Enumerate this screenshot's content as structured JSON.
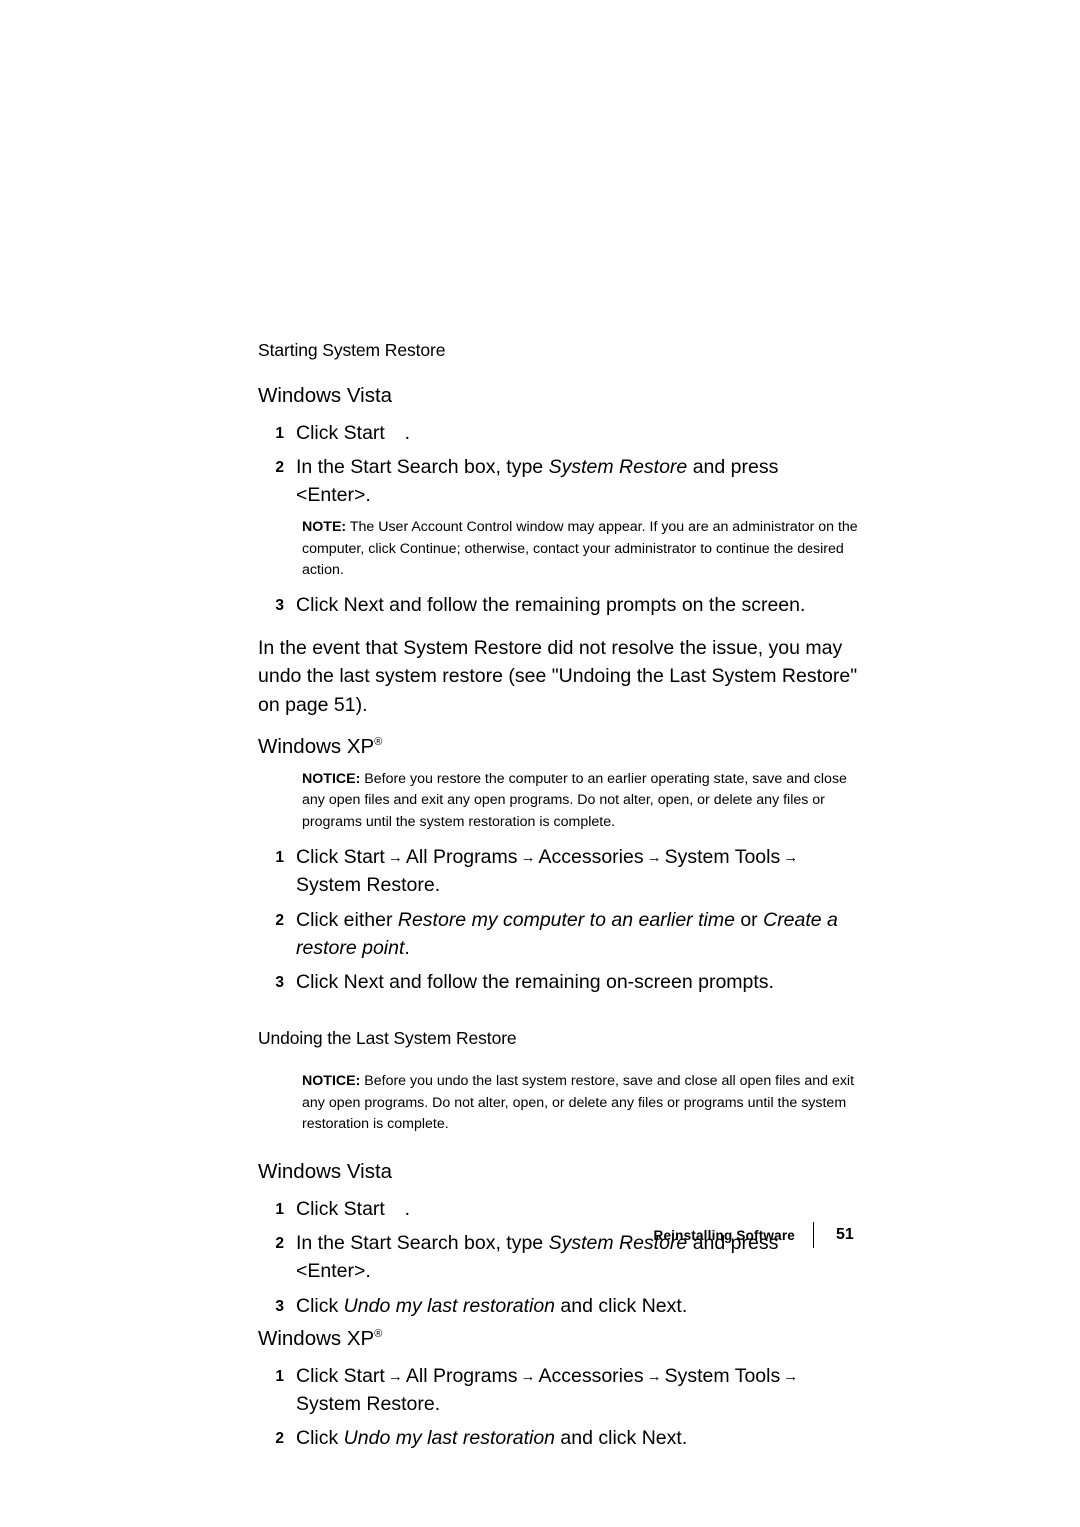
{
  "page": {
    "section_heading": "Starting System Restore",
    "footer": {
      "label": "Reinstalling Software",
      "page_number": "51"
    }
  },
  "vista1": {
    "heading": "Windows Vista",
    "heading_sup": "",
    "steps": [
      {
        "num": "1",
        "pre": "Click Start ",
        "icon": "",
        "post": "."
      },
      {
        "num": "2",
        "pre": "In the Start Search box, type ",
        "italic": "System Restore",
        "post": " and press <Enter>."
      }
    ],
    "note": {
      "kw": "NOTE:",
      "text_a": " The User Account Control",
      "text_b": " window may appear. If you are an administrator on the computer, click Continue",
      "text_c": "; otherwise, contact your administrator to continue the desired action."
    },
    "step3": {
      "num": "3",
      "text": "Click Next and follow the remaining prompts on the screen."
    }
  },
  "undo_para": {
    "line_a": "In the event that System Restore did not",
    "line_b": " resolve the issue, you may undo the last system restore (see \"Undoing",
    "line_c": " the Last System Restore\" on page 51)."
  },
  "xp1": {
    "heading": "Windows XP",
    "heading_sup": "®",
    "notice": {
      "kw": "NOTICE:",
      "text": " Before you restore the computer to an earlier operating state, save and close any open files and exit any open programs. Do not alter, open, or delete any files or programs until the system restoration is complete."
    },
    "steps": [
      {
        "num": "1",
        "text": "Click Start",
        "a1": "All Programs",
        "a2": "Accessories",
        "a3": "System Tools",
        "a4": "System Restore",
        "tail": "."
      },
      {
        "num": "2",
        "pre": "Click either ",
        "italic_a": "Restore my computer to an earlier time",
        "mid": " or ",
        "italic_b": "Create a restore point",
        "post": "."
      },
      {
        "num": "3",
        "text": "Click Next and follow the remaining on-screen prompts."
      }
    ]
  },
  "undoing": {
    "heading": "Undoing the Last System Restore",
    "notice": {
      "kw": "NOTICE:",
      "text": " Before you undo the last system restore, save and close all open files and exit any open programs. Do not alter, open, or delete any files or programs until the system restoration is complete."
    }
  },
  "vista2": {
    "heading": "Windows Vista",
    "steps": [
      {
        "num": "1",
        "pre": "Click Start ",
        "post": "."
      },
      {
        "num": "2",
        "pre": "In the Start Search box, type ",
        "italic": "System Restore",
        "post": " and press <Enter>."
      },
      {
        "num": "3",
        "pre": "Click ",
        "italic": "Undo my last restoration",
        "mid": " and click ",
        "bold": "Next",
        "post": "."
      }
    ]
  },
  "xp2": {
    "heading": "Windows XP",
    "heading_sup": "®",
    "steps": [
      {
        "num": "1",
        "text": "Click Start",
        "a1": "All Programs",
        "a2": "Accessories",
        "a3": "System Tools",
        "a4": "System Restore",
        "tail": "."
      },
      {
        "num": "2",
        "pre": "Click ",
        "italic": "Undo my last restoration",
        "mid": " and click ",
        "bold": "Next",
        "post": "."
      }
    ]
  }
}
